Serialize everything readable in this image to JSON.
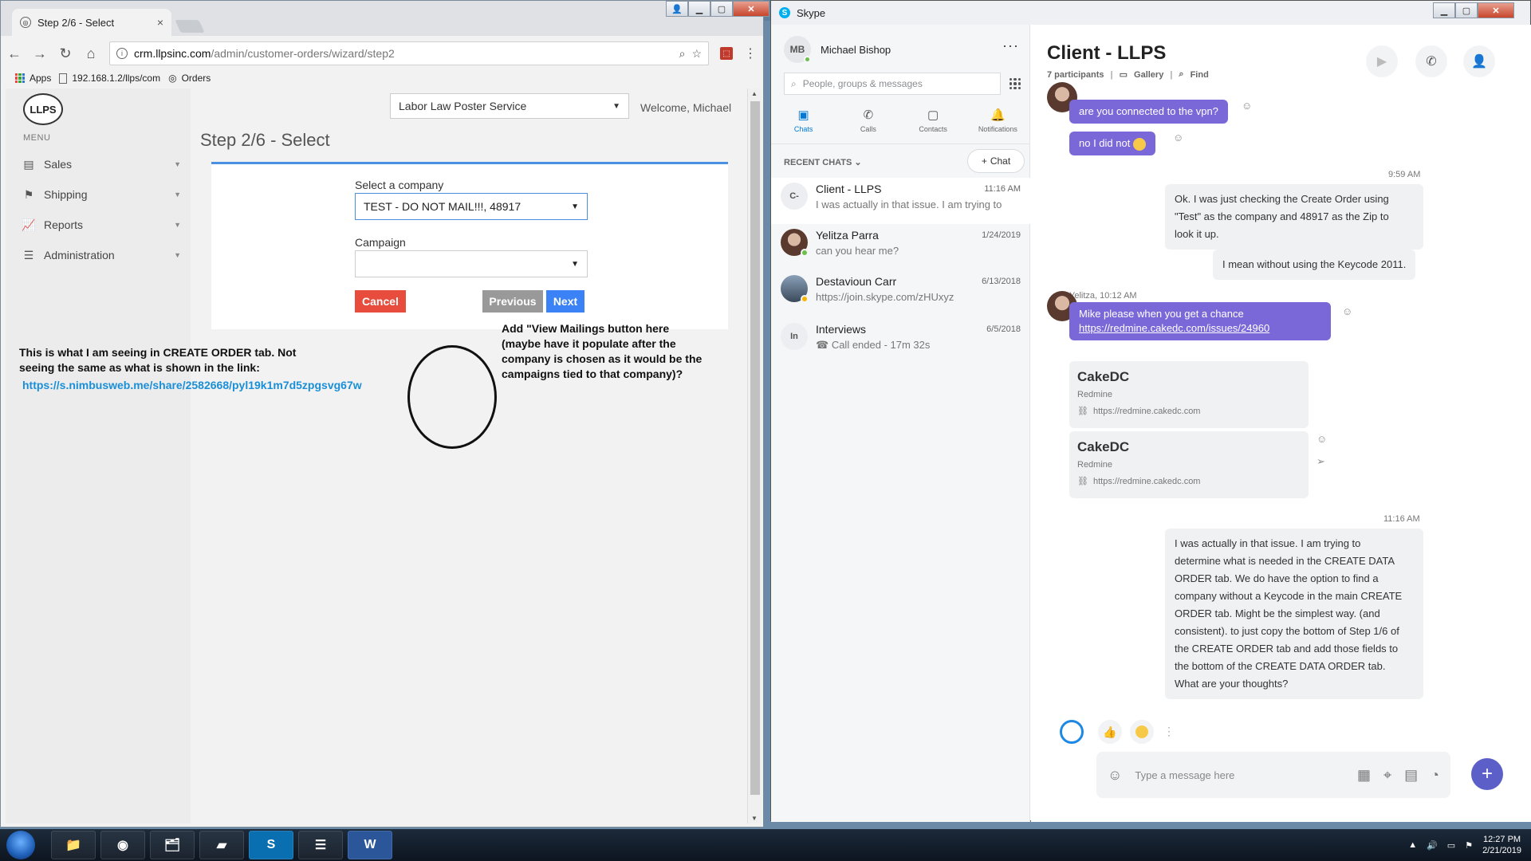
{
  "chrome": {
    "tab_title": "Step 2/6 - Select",
    "url_host": "crm.llpsinc.com",
    "url_path": "/admin/customer-orders/wizard/step2",
    "bookmarks": {
      "apps": "Apps",
      "ip": "192.168.1.2/llps/com",
      "orders": "Orders"
    }
  },
  "crm": {
    "logo_text": "LLPS",
    "menu_label": "MENU",
    "menu": [
      {
        "label": "Sales",
        "icon": "id-card-icon"
      },
      {
        "label": "Shipping",
        "icon": "signpost-icon"
      },
      {
        "label": "Reports",
        "icon": "chart-icon"
      },
      {
        "label": "Administration",
        "icon": "database-icon"
      }
    ],
    "company_dropdown": "Labor Law Poster Service",
    "welcome": "Welcome, Michael",
    "step_title": "Step 2/6 - Select",
    "form": {
      "company_label": "Select a company",
      "company_value": "TEST - DO NOT MAIL!!!, 48917",
      "campaign_label": "Campaign",
      "campaign_value": "",
      "cancel": "Cancel",
      "previous": "Previous",
      "next": "Next"
    },
    "annotation_right": [
      "Add \"View Mailings button here",
      "(maybe have it populate after the",
      "company is chosen as it would be the",
      "campaigns tied to that company)?"
    ],
    "annotation_left": [
      "This is what I am seeing in CREATE ORDER tab. Not",
      "seeing the same as what is shown in the link:"
    ],
    "annotation_link": "https://s.nimbusweb.me/share/2582668/pyl19k1m7d5zpgsvg67w"
  },
  "skype": {
    "window_title": "Skype",
    "user_initials": "MB",
    "user_name": "Michael Bishop",
    "search_placeholder": "People, groups & messages",
    "nav": [
      "Chats",
      "Calls",
      "Contacts",
      "Notifications"
    ],
    "recent_header": "RECENT CHATS",
    "new_chat": "Chat",
    "chats": [
      {
        "initials": "C-",
        "name": "Client - LLPS",
        "time": "11:16 AM",
        "preview": "I was actually in that issue. I am trying to"
      },
      {
        "initials": "",
        "name": "Yelitza Parra",
        "time": "1/24/2019",
        "preview": "can you hear me?"
      },
      {
        "initials": "",
        "name": "Destavioun Carr",
        "time": "6/13/2018",
        "preview": "https://join.skype.com/zHUxyz"
      },
      {
        "initials": "In",
        "name": "Interviews",
        "time": "6/5/2018",
        "preview": "Call ended - 17m 32s"
      }
    ],
    "conversation": {
      "title": "Client - LLPS",
      "participants": "7 participants",
      "gallery": "Gallery",
      "find": "Find",
      "messages": {
        "m1": "are you connected to the vpn?",
        "m2": "no I did not",
        "t1": "9:59 AM",
        "m3a": "Ok. I was just checking the Create Order using",
        "m3b": "\"Test\" as the company and 48917 as the Zip to",
        "m3c": "look it up.",
        "m4": "I mean without using the Keycode 2011.",
        "sender2": "Yelitza, 10:12 AM",
        "m5": "Mike please when you get a chance",
        "m5_link": "https://redmine.cakedc.com/issues/24960",
        "card_title": "CakeDC",
        "card_sub": "Redmine",
        "card_url": "https://redmine.cakedc.com",
        "t2": "11:16 AM",
        "m6": [
          "I was actually in that issue. I am trying to",
          "determine what is needed in the CREATE DATA",
          "ORDER tab. We do have the option to find a",
          "company without a Keycode in the main CREATE",
          "ORDER tab. Might be the simplest way. (and",
          "consistent). to just copy the bottom of Step 1/6 of",
          "the CREATE ORDER tab and add those fields to",
          "the bottom of the CREATE DATA ORDER tab.",
          "What are your thoughts?"
        ]
      },
      "composer_placeholder": "Type a message here"
    }
  },
  "taskbar": {
    "time": "12:27 PM",
    "date": "2/21/2019"
  }
}
